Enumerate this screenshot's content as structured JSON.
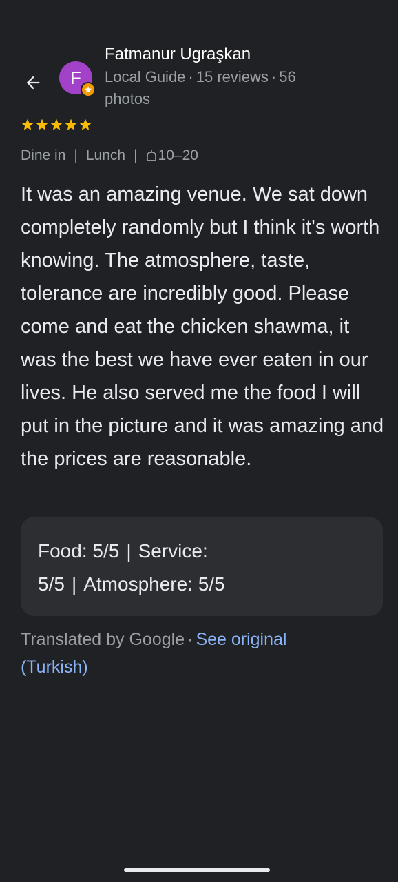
{
  "reviewer": {
    "name": "Fatmanur Ugraşkan",
    "avatar_letter": "F",
    "avatar_color": "#a142c9",
    "badge_color": "#f29900",
    "level": "Local Guide",
    "reviews": "15 reviews",
    "photos": "56 photos",
    "separator": "·"
  },
  "rating": {
    "stars": 5,
    "max": 5,
    "star_color": "#fbbc04"
  },
  "tags": {
    "service": "Dine in",
    "meal": "Lunch",
    "price": "10–20",
    "separator": "|"
  },
  "review": {
    "text": "It was an amazing venue. We sat down completely randomly but I think it's worth knowing. The atmosphere, taste, tolerance are incredibly good. Please come and eat the chicken shawma, it was the best we have ever eaten in our lives. He also served me the food I will put in the picture and it was amazing and the prices are reasonable."
  },
  "ratings_card": {
    "food": "Food: 5/5",
    "service": "Service: 5/5",
    "atmosphere": "Atmosphere: 5/5",
    "separator": "|"
  },
  "translation": {
    "label": "Translated by Google",
    "separator": "·",
    "link": "See original (Turkish)",
    "link_color": "#8ab4f8"
  },
  "icons": {
    "back": "arrow-back-icon",
    "star": "star-icon",
    "badge": "local-guide-badge-icon",
    "price": "price-icon"
  }
}
